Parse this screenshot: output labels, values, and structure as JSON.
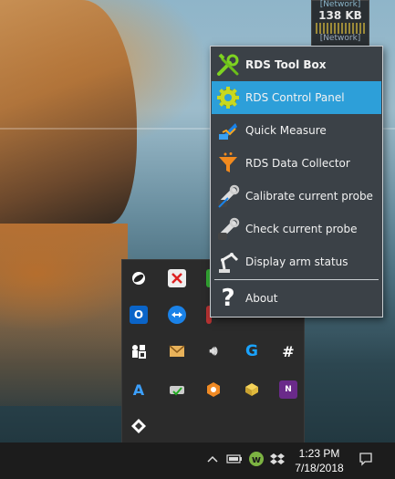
{
  "network_widget": {
    "top_label": "[Network]",
    "value": "138 KB",
    "bottom_label": "[Network]"
  },
  "menu": {
    "items": [
      {
        "label": "RDS Tool Box",
        "icon": "wrench-screwdriver-icon"
      },
      {
        "label": "RDS Control Panel",
        "icon": "gear-icon"
      },
      {
        "label": "Quick Measure",
        "icon": "ruler-measure-icon"
      },
      {
        "label": "RDS Data Collector",
        "icon": "funnel-icon"
      },
      {
        "label": "Calibrate current probe",
        "icon": "probe-icon"
      },
      {
        "label": "Check current probe",
        "icon": "probe-icon"
      },
      {
        "label": "Display arm status",
        "icon": "robot-arm-icon"
      },
      {
        "label": "About",
        "icon": "question-mark-icon"
      }
    ],
    "highlighted_index": 1,
    "highlight_color": "#2d9fd9",
    "background_color": "#3b4147"
  },
  "tray": {
    "icons": [
      "satellite-icon",
      "red-x-app-icon",
      "green-app-icon",
      "outlook-icon",
      "teamviewer-icon",
      "grid-app-icon",
      "mail-icon",
      "speaker-icon",
      "logitech-g-icon",
      "hash-app-icon",
      "azure-icon",
      "sync-drive-icon",
      "cube-app-icon",
      "box-app-icon",
      "vs-app-icon",
      "diamond-app-icon"
    ]
  },
  "taskbar": {
    "time": "1:23 PM",
    "date": "7/18/2018",
    "icons": [
      "chevron-up-icon",
      "battery-icon",
      "w-app-icon",
      "dropbox-icon",
      "notification-icon"
    ]
  }
}
